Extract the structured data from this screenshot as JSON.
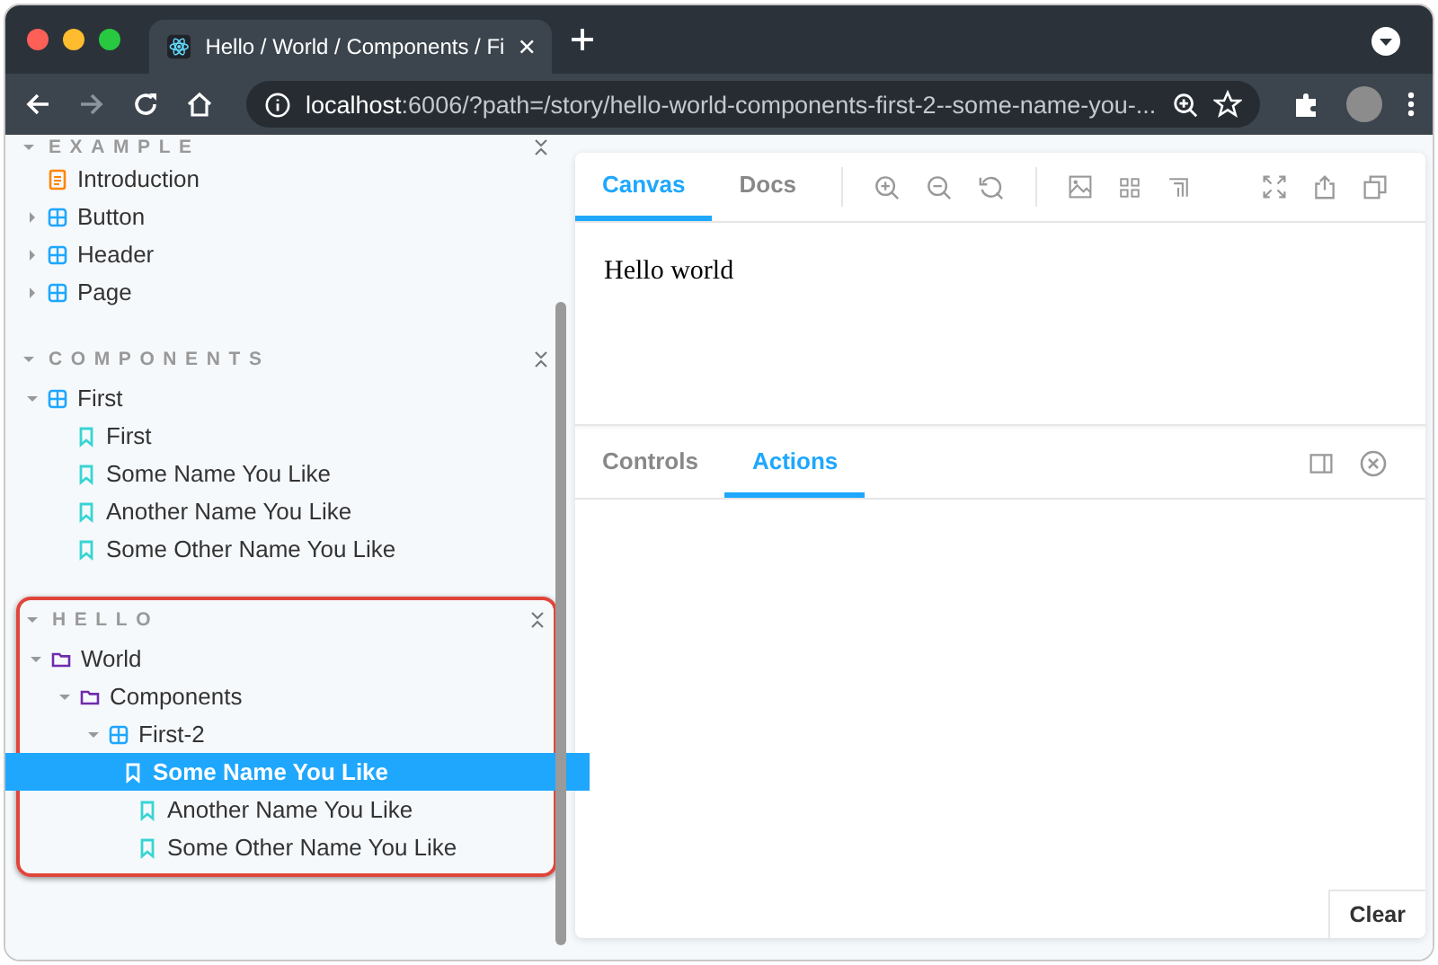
{
  "browser": {
    "tab_title": "Hello / World / Components / Fi",
    "url_host": "localhost",
    "url_rest": ":6006/?path=/story/hello-world-components-first-2--some-name-you-..."
  },
  "sidebar": {
    "sections": [
      {
        "title": "EXAMPLE",
        "highlighted": false,
        "items": [
          {
            "label": "Introduction",
            "kind": "document"
          },
          {
            "label": "Button",
            "kind": "component",
            "expanded": false
          },
          {
            "label": "Header",
            "kind": "component",
            "expanded": false
          },
          {
            "label": "Page",
            "kind": "component",
            "expanded": false
          }
        ]
      },
      {
        "title": "COMPONENTS",
        "highlighted": false,
        "items": [
          {
            "label": "First",
            "kind": "component",
            "expanded": true,
            "children": [
              {
                "label": "First",
                "kind": "story",
                "selected": false
              },
              {
                "label": "Some Name You Like",
                "kind": "story",
                "selected": false
              },
              {
                "label": "Another Name You Like",
                "kind": "story",
                "selected": false
              },
              {
                "label": "Some Other Name You Like",
                "kind": "story",
                "selected": false
              }
            ]
          }
        ]
      },
      {
        "title": "HELLO",
        "highlighted": true,
        "items": [
          {
            "label": "World",
            "kind": "folder",
            "expanded": true,
            "children": [
              {
                "label": "Components",
                "kind": "folder",
                "expanded": true,
                "children": [
                  {
                    "label": "First-2",
                    "kind": "component",
                    "expanded": true,
                    "children": [
                      {
                        "label": "Some Name You Like",
                        "kind": "story",
                        "selected": true
                      },
                      {
                        "label": "Another Name You Like",
                        "kind": "story",
                        "selected": false
                      },
                      {
                        "label": "Some Other Name You Like",
                        "kind": "story",
                        "selected": false
                      }
                    ]
                  }
                ]
              }
            ]
          }
        ]
      }
    ]
  },
  "preview": {
    "tabs": [
      {
        "label": "Canvas",
        "selected": true
      },
      {
        "label": "Docs",
        "selected": false
      }
    ],
    "content": "Hello world"
  },
  "addons": {
    "tabs": [
      {
        "label": "Controls",
        "selected": false
      },
      {
        "label": "Actions",
        "selected": true
      }
    ],
    "clear_button": "Clear"
  }
}
